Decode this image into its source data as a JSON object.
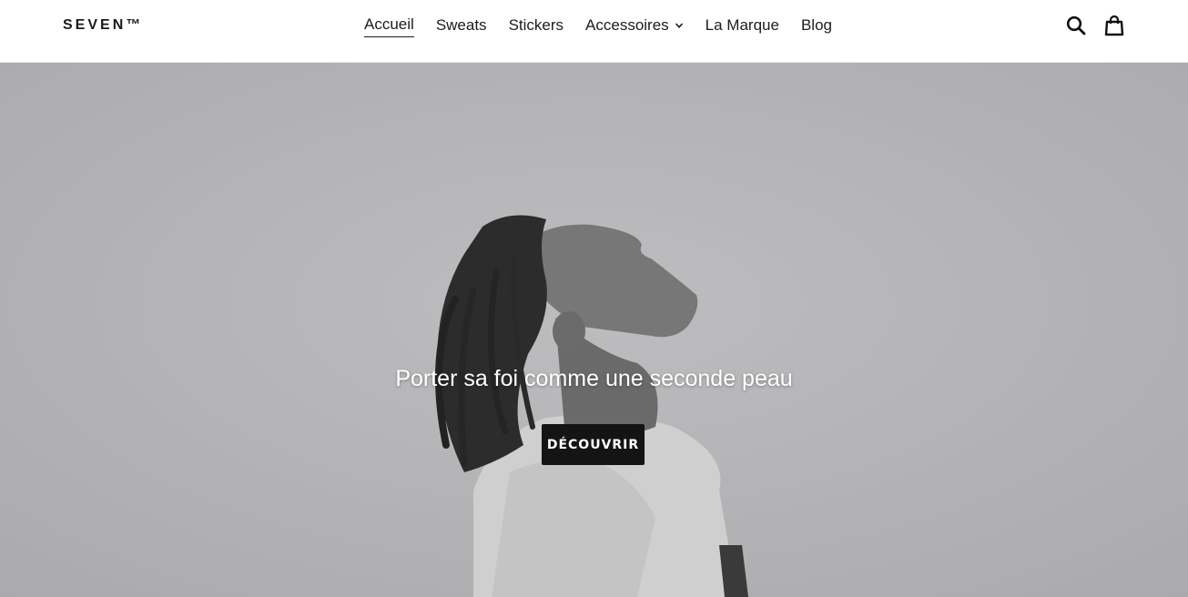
{
  "header": {
    "logo": "SEVEN™",
    "nav": [
      {
        "label": "Accueil",
        "active": true
      },
      {
        "label": "Sweats"
      },
      {
        "label": "Stickers"
      },
      {
        "label": "Accessoires",
        "has_dropdown": true
      },
      {
        "label": "La Marque"
      },
      {
        "label": "Blog"
      }
    ],
    "icons": [
      "search-icon",
      "cart-icon"
    ]
  },
  "hero": {
    "title": "Porter sa foi comme une seconde peau",
    "button_label": "DÉCOUVRIR",
    "background_color": "#b3b3b5",
    "image": "grayscale photo of a person with dreadlocks in a hoodie looking upward"
  },
  "colors": {
    "button_bg": "#141414",
    "text_dark": "#1c1c1c"
  }
}
